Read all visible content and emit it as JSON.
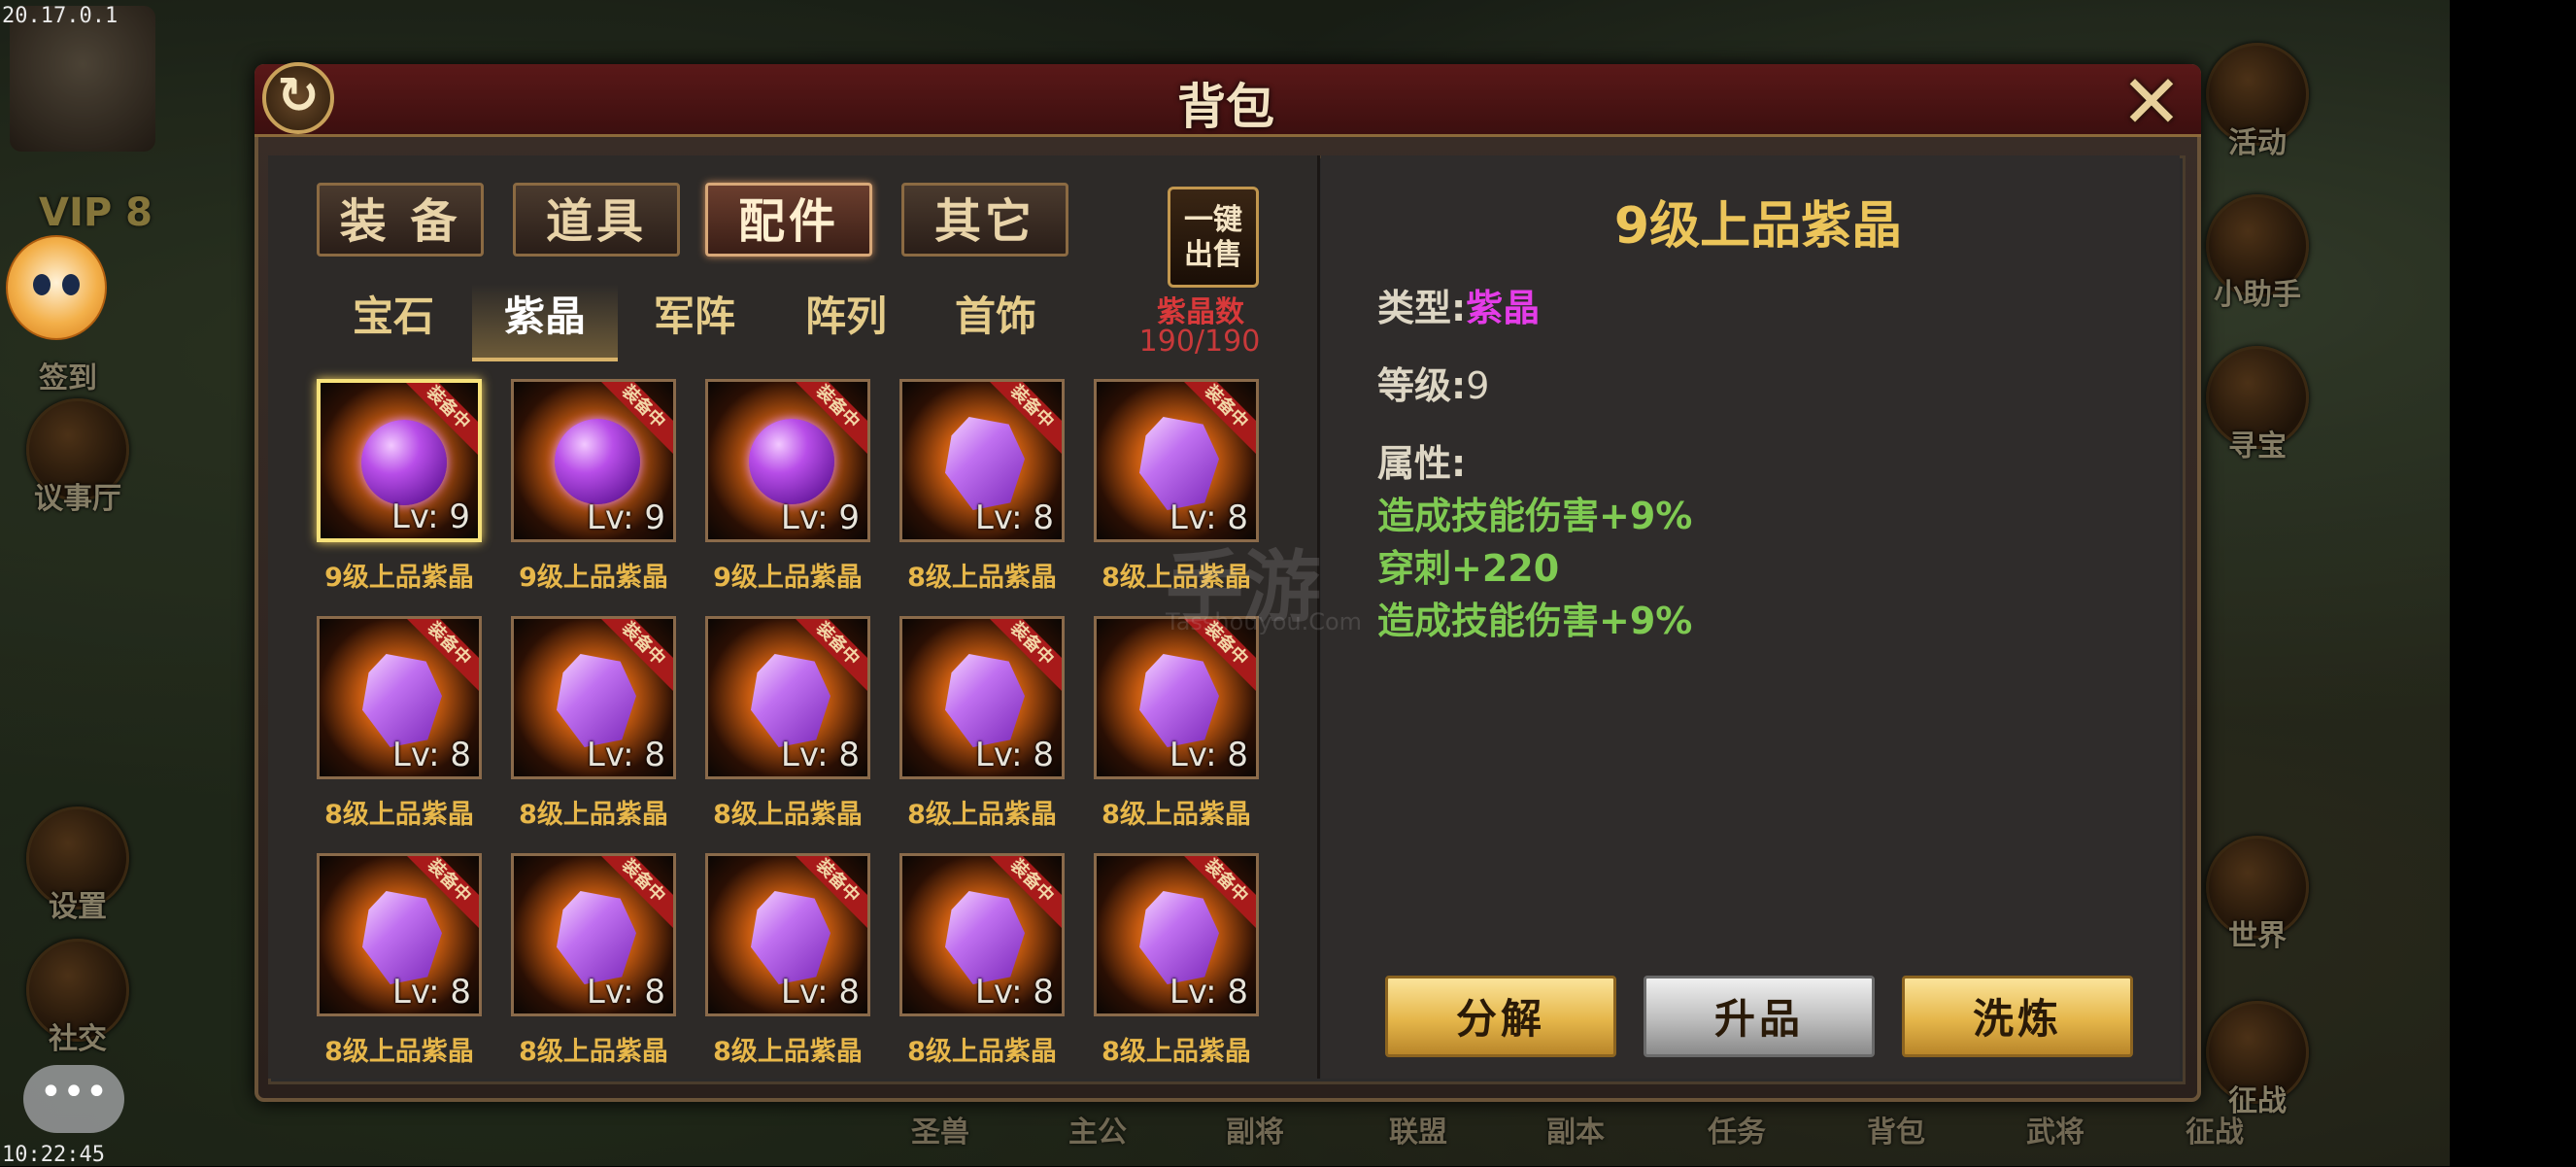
{
  "status": {
    "ip": "20.17.0.1",
    "time": "10:22:45"
  },
  "hud": {
    "vip_label": "VIP 8"
  },
  "left_menu": [
    {
      "label": "签到",
      "icon": "sign-in-icon"
    },
    {
      "label": "议事厅",
      "icon": "council-hall-icon"
    },
    {
      "label": "设置",
      "icon": "settings-gear-icon"
    },
    {
      "label": "社交",
      "icon": "social-icon"
    }
  ],
  "right_menu": [
    {
      "label": "活动",
      "icon": "gift-box-icon"
    },
    {
      "label": "小助手",
      "icon": "scroll-icon"
    },
    {
      "label": "寻宝",
      "icon": "treasure-chest-icon"
    },
    {
      "label": "世界",
      "icon": "world-dragon-icon"
    },
    {
      "label": "征战",
      "icon": "battle-dragon-icon"
    }
  ],
  "bottom_nav": [
    "圣兽",
    "主公",
    "副将",
    "联盟",
    "副本",
    "任务",
    "背包",
    "武将",
    "征战"
  ],
  "panel": {
    "title": "背包",
    "tabs": [
      {
        "label": "装 备",
        "active": false
      },
      {
        "label": "道具",
        "active": false
      },
      {
        "label": "配件",
        "active": true
      },
      {
        "label": "其它",
        "active": false
      }
    ],
    "subtabs": [
      {
        "label": "宝石",
        "active": false
      },
      {
        "label": "紫晶",
        "active": true
      },
      {
        "label": "军阵",
        "active": false
      },
      {
        "label": "阵列",
        "active": false
      },
      {
        "label": "首饰",
        "active": false
      }
    ],
    "sell_button": {
      "line1": "一键",
      "line2": "出售"
    },
    "count_label": "紫晶数",
    "count_value": "190/190",
    "equipped_ribbon": "装备中",
    "items": [
      {
        "name": "9级上品紫晶",
        "lv": "Lv: 9",
        "shape": "orb",
        "selected": true
      },
      {
        "name": "9级上品紫晶",
        "lv": "Lv: 9",
        "shape": "orb",
        "selected": false
      },
      {
        "name": "9级上品紫晶",
        "lv": "Lv: 9",
        "shape": "orb",
        "selected": false
      },
      {
        "name": "8级上品紫晶",
        "lv": "Lv: 8",
        "shape": "crystal",
        "selected": false
      },
      {
        "name": "8级上品紫晶",
        "lv": "Lv: 8",
        "shape": "crystal",
        "selected": false
      },
      {
        "name": "8级上品紫晶",
        "lv": "Lv: 8",
        "shape": "crystal",
        "selected": false
      },
      {
        "name": "8级上品紫晶",
        "lv": "Lv: 8",
        "shape": "crystal",
        "selected": false
      },
      {
        "name": "8级上品紫晶",
        "lv": "Lv: 8",
        "shape": "crystal",
        "selected": false
      },
      {
        "name": "8级上品紫晶",
        "lv": "Lv: 8",
        "shape": "crystal",
        "selected": false
      },
      {
        "name": "8级上品紫晶",
        "lv": "Lv: 8",
        "shape": "crystal",
        "selected": false
      },
      {
        "name": "8级上品紫晶",
        "lv": "Lv: 8",
        "shape": "crystal",
        "selected": false
      },
      {
        "name": "8级上品紫晶",
        "lv": "Lv: 8",
        "shape": "crystal",
        "selected": false
      },
      {
        "name": "8级上品紫晶",
        "lv": "Lv: 8",
        "shape": "crystal",
        "selected": false
      },
      {
        "name": "8级上品紫晶",
        "lv": "Lv: 8",
        "shape": "crystal",
        "selected": false
      },
      {
        "name": "8级上品紫晶",
        "lv": "Lv: 8",
        "shape": "crystal",
        "selected": false
      }
    ]
  },
  "detail": {
    "title": "9级上品紫晶",
    "type_label": "类型:",
    "type_value": "紫晶",
    "level_label": "等级:",
    "level_value": "9",
    "attr_label": "属性:",
    "attrs": [
      "造成技能伤害+9%",
      "穿刺+220",
      "造成技能伤害+9%"
    ],
    "buttons": {
      "decompose": "分解",
      "upgrade": "升品",
      "refine": "洗炼"
    }
  },
  "watermark": {
    "line1": "手游",
    "line2": "Tasshouyou.Com"
  },
  "colors": {
    "title_gold": "#ecc55a",
    "attr_green": "#7fca52",
    "type_purple": "#e43ce8",
    "count_red": "#d8393a"
  }
}
